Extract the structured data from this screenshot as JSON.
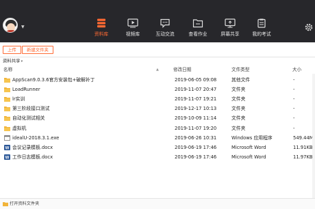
{
  "nav": {
    "items": [
      {
        "label": "资料库",
        "icon": "database-stack-icon",
        "active": true
      },
      {
        "label": "视频库",
        "icon": "video-player-icon",
        "active": false
      },
      {
        "label": "互动交流",
        "icon": "chat-bubble-icon",
        "active": false
      },
      {
        "label": "查看作业",
        "icon": "homework-folder-icon",
        "active": false
      },
      {
        "label": "屏幕共享",
        "icon": "screen-share-icon",
        "active": false
      },
      {
        "label": "我的考试",
        "icon": "exam-clipboard-icon",
        "active": false
      }
    ],
    "accent": "#ff6a33",
    "bar_color": "#27272b"
  },
  "toolbar": {
    "upload_label": "上传",
    "new_folder_label": "新建文件夹"
  },
  "breadcrumb": {
    "label": "资料共享",
    "arrow": "▾"
  },
  "table": {
    "headers": {
      "name": "名称",
      "modified": "修改日期",
      "type": "文件类型",
      "size": "大小"
    },
    "rows": [
      {
        "name": "AppScan9.0.3.6官方安装包+破解补丁",
        "modified": "2019-06-05 09:08",
        "type": "其他文件",
        "size": "-",
        "icon": "folder"
      },
      {
        "name": "LoadRunner",
        "modified": "2019-11-07 20:47",
        "type": "文件夹",
        "size": "-",
        "icon": "folder"
      },
      {
        "name": "lr实训",
        "modified": "2019-11-07 19:21",
        "type": "文件夹",
        "size": "-",
        "icon": "folder"
      },
      {
        "name": "第三阶段接口测试",
        "modified": "2019-12-17 10:13",
        "type": "文件夹",
        "size": "-",
        "icon": "folder"
      },
      {
        "name": "自动化测试相关",
        "modified": "2019-10-09 11:14",
        "type": "文件夹",
        "size": "-",
        "icon": "folder"
      },
      {
        "name": "虚拟机",
        "modified": "2019-11-07 19:20",
        "type": "文件夹",
        "size": "-",
        "icon": "folder"
      },
      {
        "name": "idealU-2018.3.1.exe",
        "modified": "2019-06-26 10:31",
        "type": "Windows 应用程序",
        "size": "549.44MB",
        "icon": "exe"
      },
      {
        "name": "会议记录模板.docx",
        "modified": "2019-06-19 17:46",
        "type": "Microsoft Word",
        "size": "11.91KB",
        "icon": "word"
      },
      {
        "name": "工作日志模板.docx",
        "modified": "2019-06-19 17:46",
        "type": "Microsoft Word",
        "size": "11.97KB",
        "icon": "word"
      }
    ]
  },
  "footer": {
    "label": "打开资料文件夹"
  }
}
